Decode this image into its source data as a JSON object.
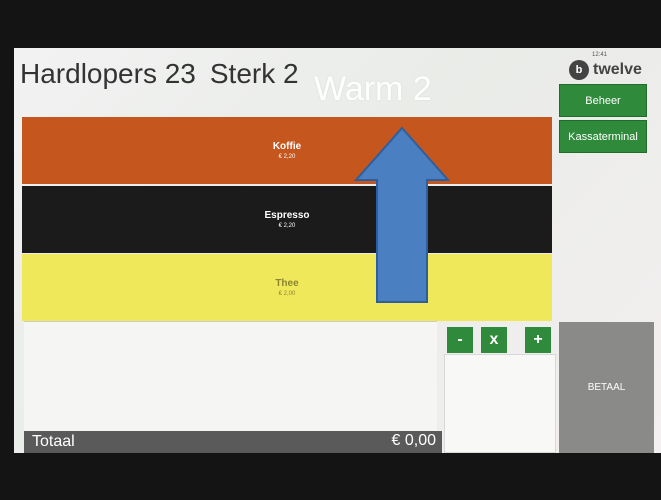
{
  "header": {
    "title_parts": [
      "Hardlopers 23",
      "Sterk 2"
    ],
    "overlay_text": "Warm 2"
  },
  "logo": {
    "time": "12:41",
    "badge": "b",
    "text": "twelve"
  },
  "side_buttons": {
    "beheer": "Beheer",
    "kassaterminal": "Kassaterminal"
  },
  "products": [
    {
      "name": "Koffie",
      "price": "€ 2,20",
      "color": "#c4561e"
    },
    {
      "name": "Espresso",
      "price": "€ 2,20",
      "color": "#1b1b1b"
    },
    {
      "name": "Thee",
      "price": "€ 2,00",
      "color": "#efe85a"
    }
  ],
  "controls": {
    "minus": "-",
    "remove": "x",
    "plus": "+"
  },
  "totals": {
    "label": "Totaal",
    "value": "€ 0,00"
  },
  "pay_button": "BETAAL",
  "colors": {
    "accent_green": "#2f8a3c",
    "arrow_blue": "#4a7fc1"
  }
}
